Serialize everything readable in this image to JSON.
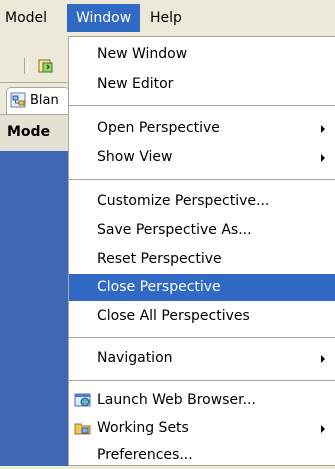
{
  "menubar": {
    "items": [
      {
        "label": "Model"
      },
      {
        "label": "Window"
      },
      {
        "label": "Help"
      }
    ]
  },
  "editor_tab": {
    "label": "Blan",
    "icon": "diagram-file-icon"
  },
  "view": {
    "title": "Mode"
  },
  "toolbar": {
    "button_icon": "new-wizard-icon"
  },
  "menu": {
    "items": [
      {
        "label": "New Window"
      },
      {
        "label": "New Editor"
      },
      {
        "label": "Open Perspective"
      },
      {
        "label": "Show View"
      },
      {
        "label": "Customize Perspective..."
      },
      {
        "label": "Save Perspective As..."
      },
      {
        "label": "Reset Perspective"
      },
      {
        "label": "Close Perspective"
      },
      {
        "label": "Close All Perspectives"
      },
      {
        "label": "Navigation"
      },
      {
        "label": "Launch Web Browser...",
        "icon": "web-browser-icon"
      },
      {
        "label": "Working Sets",
        "icon": "working-sets-icon"
      },
      {
        "label": "Preferences..."
      }
    ]
  },
  "colors": {
    "highlight": "#316ac5",
    "window_bg": "#ece9d8",
    "pane_blue": "#3e68b3"
  }
}
